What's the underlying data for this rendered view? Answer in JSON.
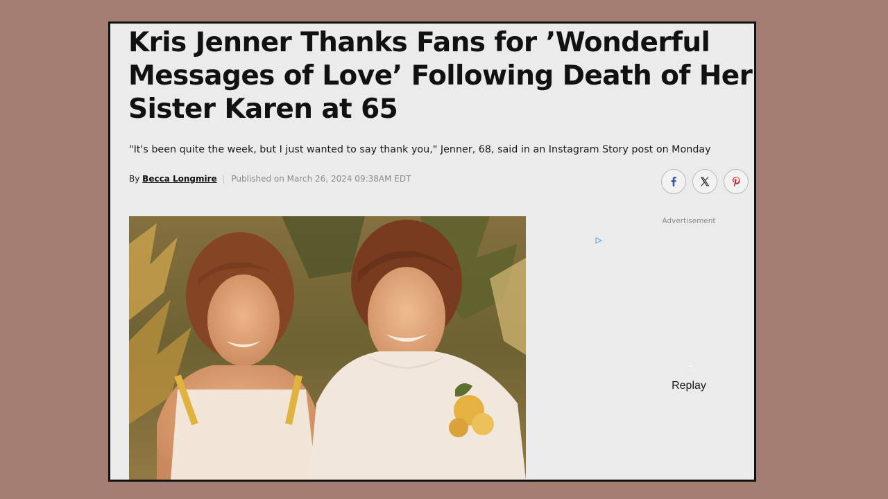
{
  "article": {
    "headline": "Kris Jenner Thanks Fans for ’Wonderful Messages of Love’ Following Death of Her Sister Karen at 65",
    "dek": "\"It's been quite the week, but I just wanted to say thank you,\" Jenner, 68, said in an Instagram Story post on Monday",
    "byline_prefix": "By",
    "author": "Becca Longmire",
    "published": "Published on March 26, 2024 09:38AM EDT"
  },
  "share": {
    "facebook_icon": "facebook-icon",
    "x_icon": "x-icon",
    "pinterest_icon": "pinterest-icon"
  },
  "ad": {
    "label": "Advertisement",
    "replay_label": "Replay"
  },
  "colors": {
    "page_background": "#a47d72",
    "frame_border": "#111111",
    "facebook": "#3b5998",
    "pinterest": "#c8232c"
  }
}
